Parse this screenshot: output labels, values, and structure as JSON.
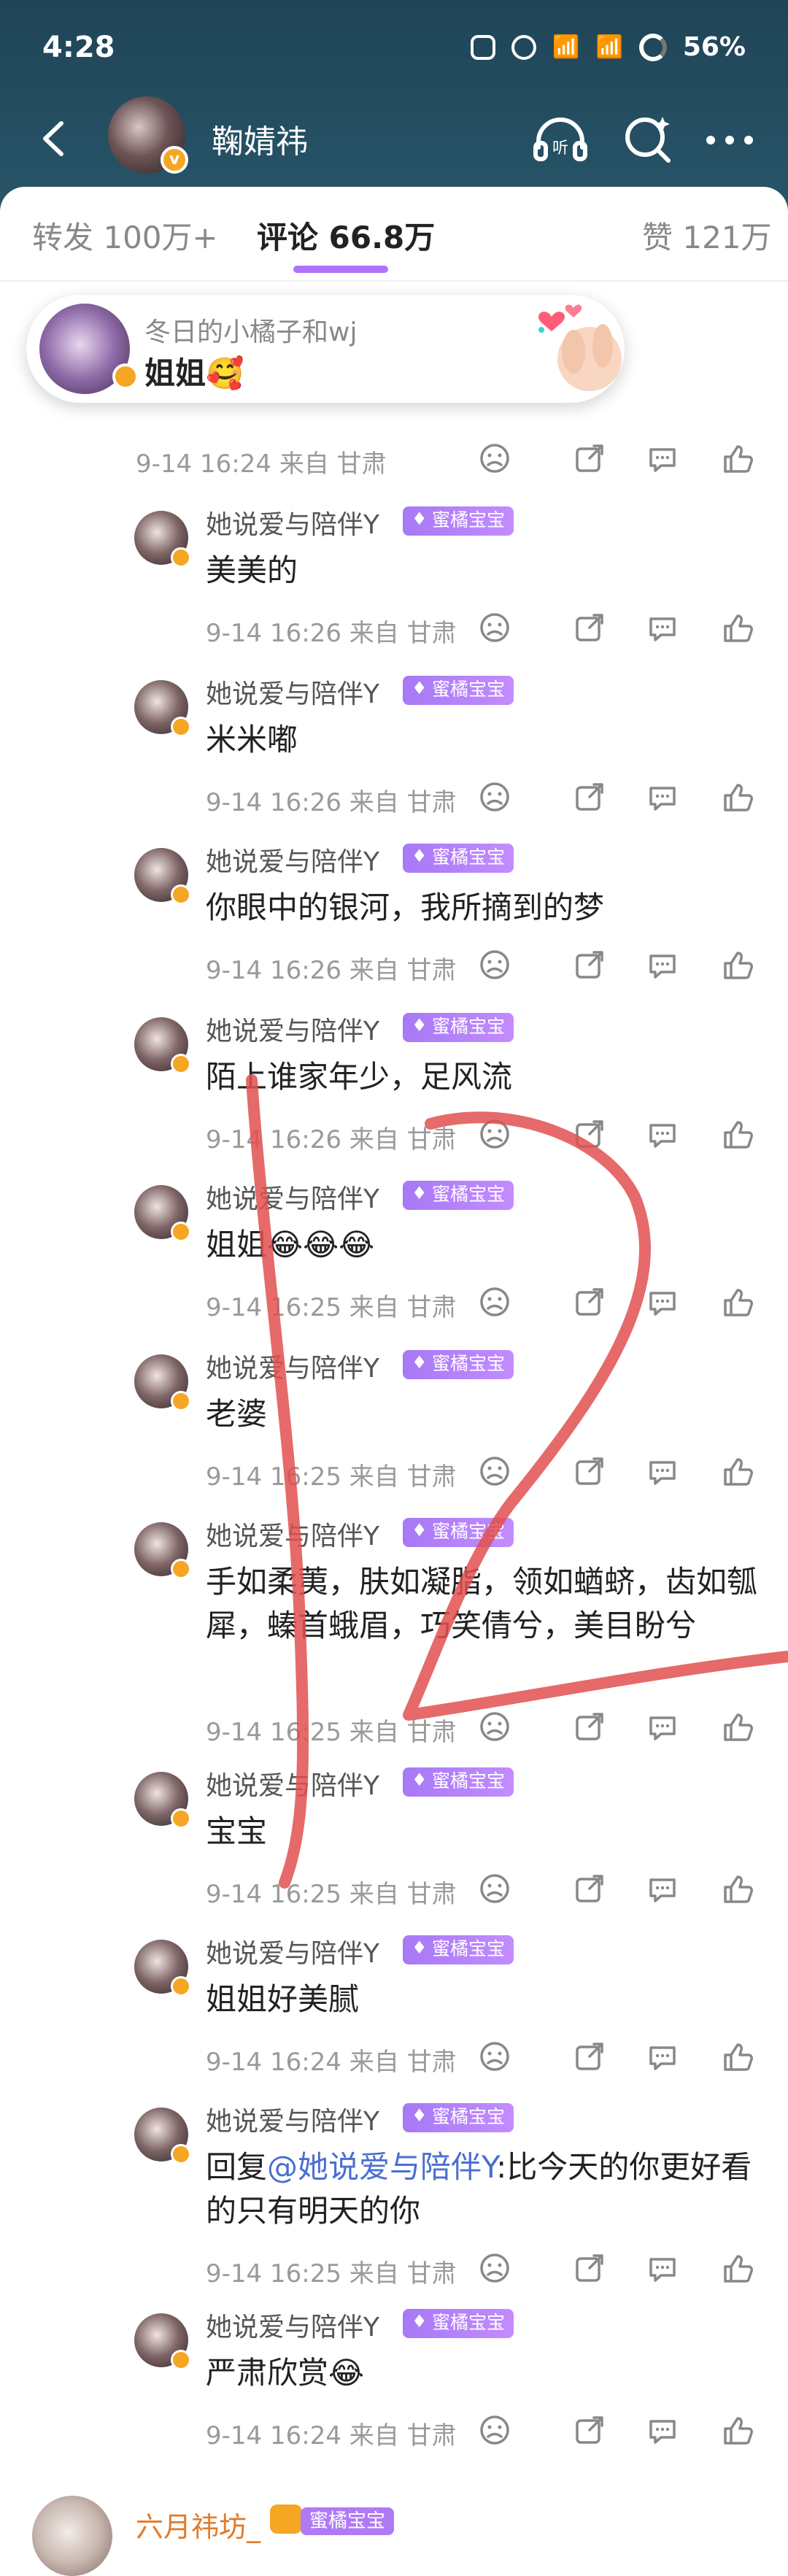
{
  "status_bar": {
    "time": "4:28",
    "battery": "56%"
  },
  "nav": {
    "title": "鞠婧祎",
    "avatar_badge": "v"
  },
  "tabs": [
    {
      "label": "转发 100万+",
      "active": false
    },
    {
      "label": "评论 66.8万",
      "active": true
    },
    {
      "label": "赞 121万",
      "active": false
    }
  ],
  "parent_comment": {
    "user": "冬日的小橘子和wj",
    "text": "姐姐🥰"
  },
  "first_meta": "9-14 16:24  来自 甘肃",
  "replies": [
    {
      "user": "她说爱与陪伴Y",
      "tag": "蜜橘宝宝",
      "text": "美美的",
      "meta": "9-14 16:26  来自 甘肃"
    },
    {
      "user": "她说爱与陪伴Y",
      "tag": "蜜橘宝宝",
      "text": "米米嘟",
      "meta": "9-14 16:26  来自 甘肃"
    },
    {
      "user": "她说爱与陪伴Y",
      "tag": "蜜橘宝宝",
      "text": "你眼中的银河，我所摘到的梦",
      "meta": "9-14 16:26  来自 甘肃"
    },
    {
      "user": "她说爱与陪伴Y",
      "tag": "蜜橘宝宝",
      "text": "陌上谁家年少，足风流",
      "meta": "9-14 16:26  来自 甘肃"
    },
    {
      "user": "她说爱与陪伴Y",
      "tag": "蜜橘宝宝",
      "text": "姐姐😂😂😂",
      "meta": "9-14 16:25  来自 甘肃"
    },
    {
      "user": "她说爱与陪伴Y",
      "tag": "蜜橘宝宝",
      "text": "老婆",
      "meta": "9-14 16:25  来自 甘肃"
    },
    {
      "user": "她说爱与陪伴Y",
      "tag": "蜜橘宝宝",
      "text": "手如柔荑，肤如凝脂，领如蝤蛴，齿如瓠犀，螓首蛾眉，巧笑倩兮，美目盼兮",
      "meta": "9-14 16:25  来自 甘肃"
    },
    {
      "user": "她说爱与陪伴Y",
      "tag": "蜜橘宝宝",
      "text": "宝宝",
      "meta": "9-14 16:25  来自 甘肃"
    },
    {
      "user": "她说爱与陪伴Y",
      "tag": "蜜橘宝宝",
      "text": "姐姐好美腻",
      "meta": "9-14 16:24  来自 甘肃"
    },
    {
      "user": "她说爱与陪伴Y",
      "tag": "蜜橘宝宝",
      "text_prefix": "回复",
      "mention": "@她说爱与陪伴Y",
      "text": ":比今天的你更好看的只有明天的你",
      "meta": "9-14 16:25  来自 甘肃"
    },
    {
      "user": "她说爱与陪伴Y",
      "tag": "蜜橘宝宝",
      "text": "严肃欣赏😂",
      "meta": "9-14 16:24  来自 甘肃"
    }
  ],
  "next_comment": {
    "user": "六月祎坊_",
    "tag": "蜜橘宝宝"
  },
  "colors": {
    "header_bg": "#1f4457",
    "tab_accent": "#b071ff",
    "tag_purple": "#b07af5",
    "mention_blue": "#4a6fd1",
    "scribble_red": "#e0504f",
    "vip_badge": "#f5a623"
  },
  "icons": [
    "back-arrow-icon",
    "headphones-listen-icon",
    "search-icon",
    "more-icon",
    "dislike-face-icon",
    "share-icon",
    "comment-icon",
    "like-icon"
  ]
}
